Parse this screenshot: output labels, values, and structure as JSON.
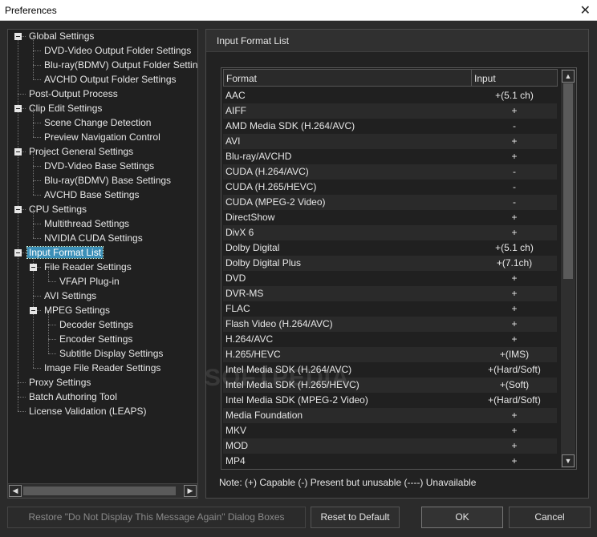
{
  "window": {
    "title": "Preferences",
    "close_glyph": "✕"
  },
  "tree": {
    "items": [
      {
        "label": "Global Settings",
        "level": 0,
        "expander": true
      },
      {
        "label": "DVD-Video Output Folder Settings",
        "level": 1
      },
      {
        "label": "Blu-ray(BDMV) Output Folder Settings",
        "level": 1
      },
      {
        "label": "AVCHD Output Folder Settings",
        "level": 1
      },
      {
        "label": "Post-Output Process",
        "level": 0
      },
      {
        "label": "Clip Edit Settings",
        "level": 0,
        "expander": true
      },
      {
        "label": "Scene Change Detection",
        "level": 1
      },
      {
        "label": "Preview Navigation Control",
        "level": 1
      },
      {
        "label": "Project General Settings",
        "level": 0,
        "expander": true
      },
      {
        "label": "DVD-Video Base Settings",
        "level": 1
      },
      {
        "label": "Blu-ray(BDMV) Base Settings",
        "level": 1
      },
      {
        "label": "AVCHD Base Settings",
        "level": 1
      },
      {
        "label": "CPU Settings",
        "level": 0,
        "expander": true
      },
      {
        "label": "Multithread Settings",
        "level": 1
      },
      {
        "label": "NVIDIA CUDA Settings",
        "level": 1
      },
      {
        "label": "Input Format List",
        "level": 0,
        "expander": true,
        "selected": true
      },
      {
        "label": "File Reader Settings",
        "level": 1,
        "expander": true
      },
      {
        "label": "VFAPI Plug-in",
        "level": 2
      },
      {
        "label": "AVI Settings",
        "level": 1
      },
      {
        "label": "MPEG Settings",
        "level": 1,
        "expander": true
      },
      {
        "label": "Decoder Settings",
        "level": 2
      },
      {
        "label": "Encoder Settings",
        "level": 2
      },
      {
        "label": "Subtitle Display Settings",
        "level": 2
      },
      {
        "label": "Image File Reader Settings",
        "level": 1
      },
      {
        "label": "Proxy Settings",
        "level": 0
      },
      {
        "label": "Batch Authoring Tool",
        "level": 0
      },
      {
        "label": "License Validation (LEAPS)",
        "level": 0
      }
    ],
    "scroll_left_glyph": "◀",
    "scroll_right_glyph": "▶"
  },
  "panel": {
    "title": "Input Format List",
    "columns": {
      "format": "Format",
      "input": "Input"
    },
    "rows": [
      {
        "format": "AAC",
        "input": "+(5.1 ch)"
      },
      {
        "format": "AIFF",
        "input": "+"
      },
      {
        "format": "AMD Media SDK (H.264/AVC)",
        "input": "-"
      },
      {
        "format": "AVI",
        "input": "+"
      },
      {
        "format": "Blu-ray/AVCHD",
        "input": "+"
      },
      {
        "format": "CUDA (H.264/AVC)",
        "input": "-"
      },
      {
        "format": "CUDA (H.265/HEVC)",
        "input": "-"
      },
      {
        "format": "CUDA (MPEG-2 Video)",
        "input": "-"
      },
      {
        "format": "DirectShow",
        "input": "+"
      },
      {
        "format": "DivX 6",
        "input": "+"
      },
      {
        "format": "Dolby Digital",
        "input": "+(5.1 ch)"
      },
      {
        "format": "Dolby Digital Plus",
        "input": "+(7.1ch)"
      },
      {
        "format": "DVD",
        "input": "+"
      },
      {
        "format": "DVR-MS",
        "input": "+"
      },
      {
        "format": "FLAC",
        "input": "+"
      },
      {
        "format": "Flash Video (H.264/AVC)",
        "input": "+"
      },
      {
        "format": "H.264/AVC",
        "input": "+"
      },
      {
        "format": "H.265/HEVC",
        "input": "+(IMS)"
      },
      {
        "format": "Intel Media SDK (H.264/AVC)",
        "input": "+(Hard/Soft)"
      },
      {
        "format": "Intel Media SDK (H.265/HEVC)",
        "input": "+(Soft)"
      },
      {
        "format": "Intel Media SDK (MPEG-2 Video)",
        "input": "+(Hard/Soft)"
      },
      {
        "format": "Media Foundation",
        "input": "+"
      },
      {
        "format": "MKV",
        "input": "+"
      },
      {
        "format": "MOD",
        "input": "+"
      },
      {
        "format": "MP4",
        "input": "+"
      }
    ],
    "scroll_up_glyph": "▲",
    "scroll_down_glyph": "▼",
    "note": "Note: (+) Capable   (-) Present but unusable   (----) Unavailable"
  },
  "buttons": {
    "restore": "Restore \"Do Not Display This Message Again\" Dialog Boxes",
    "reset": "Reset to Default",
    "ok": "OK",
    "cancel": "Cancel"
  },
  "watermark": "SOFTPEDIA"
}
